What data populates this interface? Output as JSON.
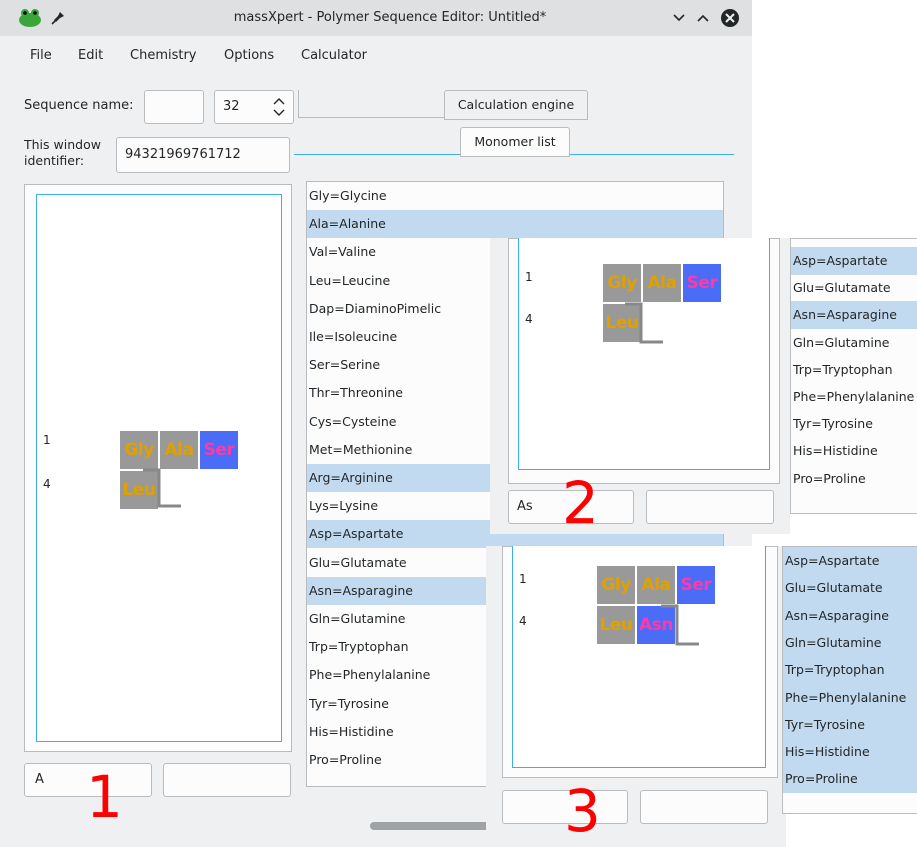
{
  "window": {
    "title": "massXpert - Polymer Sequence Editor: Untitled*"
  },
  "menu": {
    "file": "File",
    "edit": "Edit",
    "chemistry": "Chemistry",
    "options": "Options",
    "calculator": "Calculator"
  },
  "form": {
    "sequence_name_label": "Sequence name:",
    "sequence_name_value": "",
    "spin_value": "32",
    "identifier_label_line1": "This window",
    "identifier_label_line2": "identifier:",
    "identifier_value": "94321969761712"
  },
  "tabs": {
    "calculation_engine": "Calculation engine",
    "monomer_list": "Monomer list"
  },
  "monomers": [
    "Gly=Glycine",
    "Ala=Alanine",
    "Val=Valine",
    "Leu=Leucine",
    "Dap=DiaminoPimelic",
    "Ile=Isoleucine",
    "Ser=Serine",
    "Thr=Threonine",
    "Cys=Cysteine",
    "Met=Methionine",
    "Arg=Arginine",
    "Lys=Lysine",
    "Asp=Aspartate",
    "Glu=Glutamate",
    "Asn=Asparagine",
    "Gln=Glutamine",
    "Trp=Tryptophan",
    "Phe=Phenylalanine",
    "Tyr=Tyrosine",
    "His=Histidine",
    "Pro=Proline"
  ],
  "sequence": {
    "row1_index": "1",
    "row2_index": "4",
    "m_gly": "Gly",
    "m_ala": "Ala",
    "m_ser": "Ser",
    "m_leu": "Leu",
    "m_asn": "Asn"
  },
  "panel1": {
    "input": "A",
    "step": "1"
  },
  "panel2": {
    "input": "As",
    "step": "2",
    "list": [
      "Asp=Aspartate",
      "Glu=Glutamate",
      "Asn=Asparagine",
      "Gln=Glutamine",
      "Trp=Tryptophan",
      "Phe=Phenylalanine",
      "Tyr=Tyrosine",
      "His=Histidine",
      "Pro=Proline"
    ]
  },
  "panel3": {
    "input": "",
    "step": "3",
    "list": [
      "Asp=Aspartate",
      "Glu=Glutamate",
      "Asn=Asparagine",
      "Gln=Glutamine",
      "Trp=Tryptophan",
      "Phe=Phenylalanine",
      "Tyr=Tyrosine",
      "His=Histidine",
      "Pro=Proline"
    ]
  },
  "colors": {
    "selection": "#c2daf0",
    "accent": "#3daee9",
    "monomer_grey": "#999999",
    "monomer_blue": "#4a6cf7",
    "annotation_red": "#ff0000"
  }
}
